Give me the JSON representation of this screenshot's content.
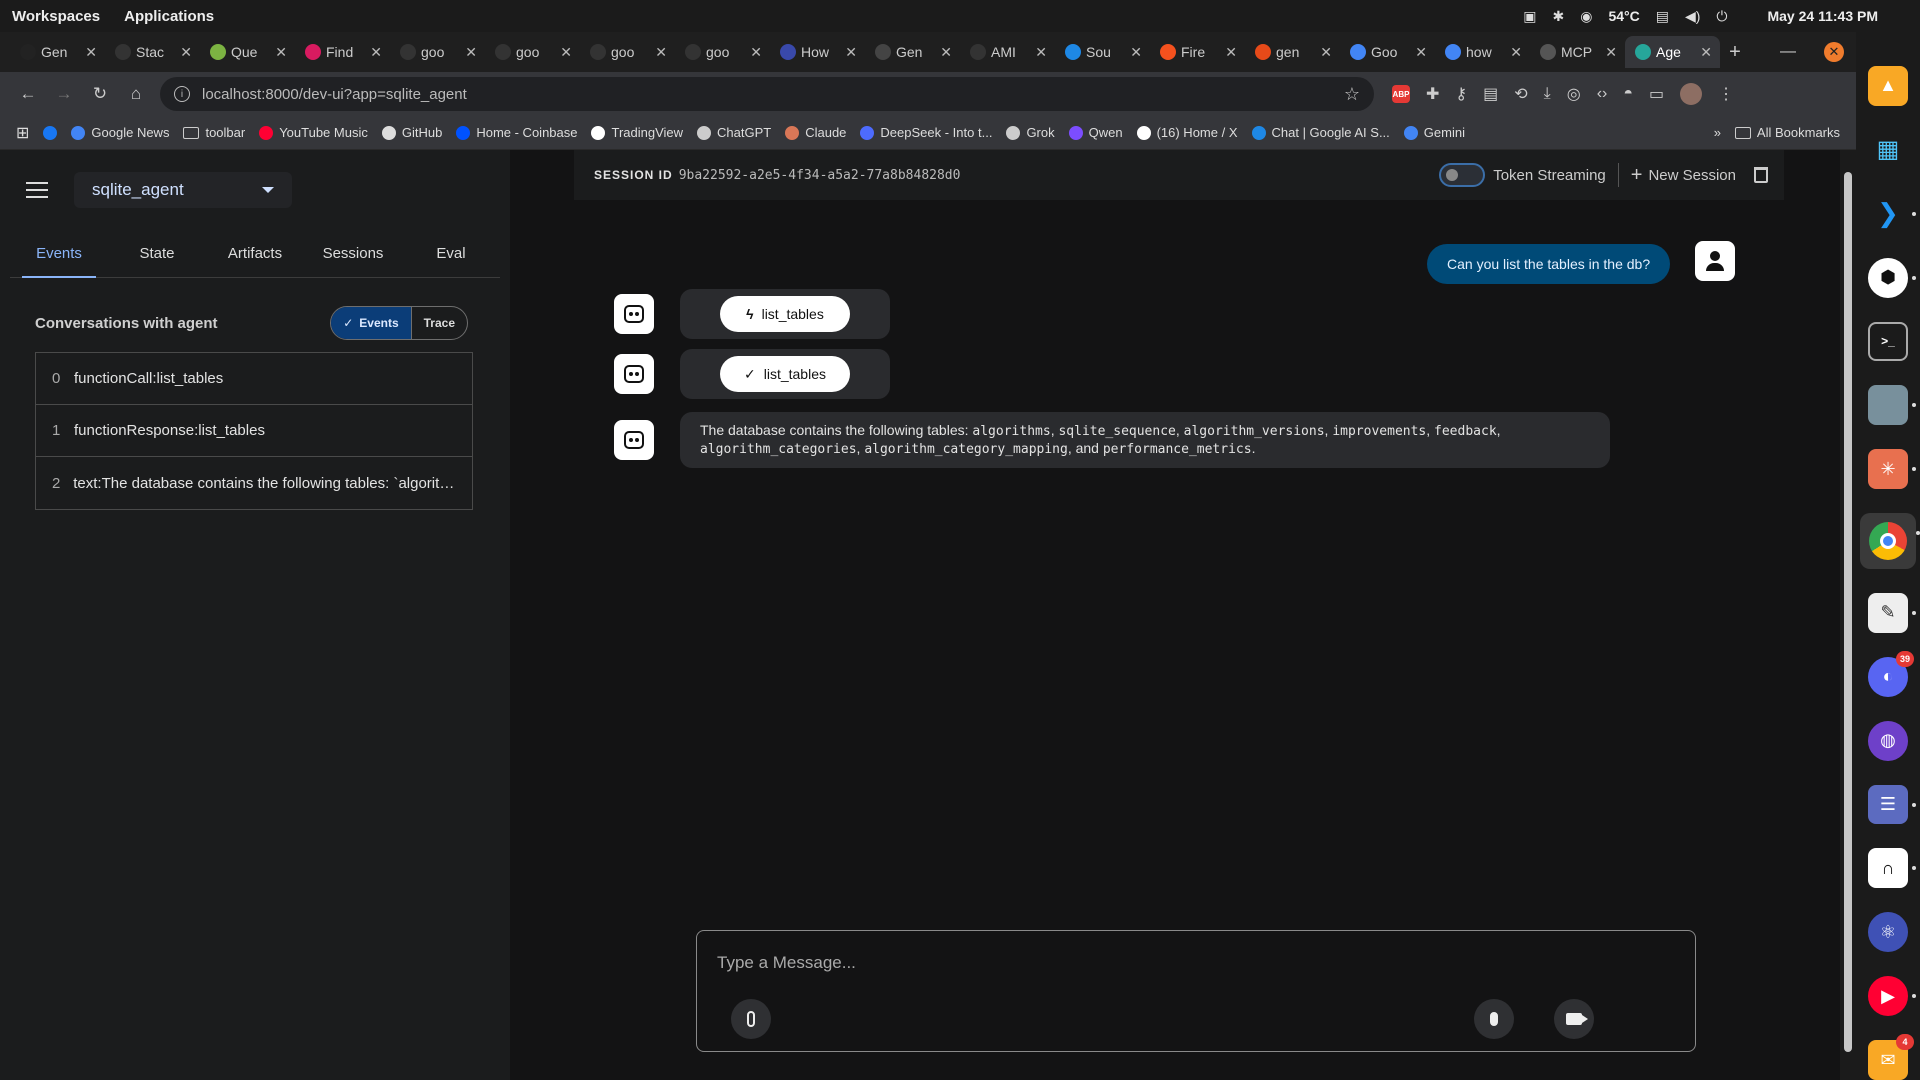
{
  "os": {
    "workspaces": "Workspaces",
    "applications": "Applications",
    "temperature": "54°C",
    "datetime": "May 24  11:43 PM"
  },
  "tabs": [
    {
      "label": "Gen",
      "icon": "openai-icon",
      "color": "#222222"
    },
    {
      "label": "Stac",
      "icon": "github-icon",
      "color": "#333333"
    },
    {
      "label": "Que",
      "icon": "quest-icon",
      "color": "#7cb342"
    },
    {
      "label": "Find",
      "icon": "find-icon",
      "color": "#d81b60"
    },
    {
      "label": "goo",
      "icon": "github-icon",
      "color": "#333333"
    },
    {
      "label": "goo",
      "icon": "github-icon",
      "color": "#333333"
    },
    {
      "label": "goo",
      "icon": "github-icon",
      "color": "#333333"
    },
    {
      "label": "goo",
      "icon": "github-icon",
      "color": "#333333"
    },
    {
      "label": "How",
      "icon": "how-icon",
      "color": "#3949ab"
    },
    {
      "label": "Gen",
      "icon": "zb-icon",
      "color": "#444444"
    },
    {
      "label": "AMI",
      "icon": "github-icon",
      "color": "#333333"
    },
    {
      "label": "Sou",
      "icon": "butterfly-icon",
      "color": "#1e88e5"
    },
    {
      "label": "Fire",
      "icon": "fire-icon",
      "color": "#f4511e"
    },
    {
      "label": "gen",
      "icon": "flame-icon",
      "color": "#e64a19"
    },
    {
      "label": "Goo",
      "icon": "gemini-icon",
      "color": "#4285f4"
    },
    {
      "label": "how",
      "icon": "google-icon",
      "color": "#4285f4"
    },
    {
      "label": "MCP",
      "icon": "mcp-icon",
      "color": "#555555"
    },
    {
      "label": "Age",
      "icon": "agent-icon",
      "color": "#26a69a"
    }
  ],
  "address": {
    "url": "localhost:8000/dev-ui?app=sqlite_agent"
  },
  "bookmarks": [
    {
      "label": "",
      "color": "#1877f2"
    },
    {
      "label": "Google News",
      "color": "#4285f4"
    },
    {
      "label": "toolbar",
      "folder": true
    },
    {
      "label": "YouTube Music",
      "color": "#ff0033"
    },
    {
      "label": "GitHub",
      "color": "#dddddd"
    },
    {
      "label": "Home - Coinbase",
      "color": "#0052ff"
    },
    {
      "label": "TradingView",
      "color": "#ffffff"
    },
    {
      "label": "ChatGPT",
      "color": "#cccccc"
    },
    {
      "label": "Claude",
      "color": "#d97757"
    },
    {
      "label": "DeepSeek - Into t...",
      "color": "#4d6bfe"
    },
    {
      "label": "Grok",
      "color": "#cccccc"
    },
    {
      "label": "Qwen",
      "color": "#7c4dff"
    },
    {
      "label": "(16) Home / X",
      "color": "#ffffff"
    },
    {
      "label": "Chat | Google AI S...",
      "color": "#1e88e5"
    },
    {
      "label": "Gemini",
      "color": "#4285f4"
    }
  ],
  "all_bookmarks": "All Bookmarks",
  "sidebar": {
    "app_name": "sqlite_agent",
    "tabs": [
      "Events",
      "State",
      "Artifacts",
      "Sessions",
      "Eval"
    ],
    "conversations_title": "Conversations with agent",
    "toggle_events": "Events",
    "toggle_trace": "Trace",
    "events": [
      {
        "index": "0",
        "text": "functionCall:list_tables"
      },
      {
        "index": "1",
        "text": "functionResponse:list_tables"
      },
      {
        "index": "2",
        "text": "text:The database contains the following tables: `algorithm..."
      }
    ]
  },
  "session": {
    "label": "SESSION ID",
    "id": "9ba22592-a2e5-4f34-a5a2-77a8b84828d0",
    "token_streaming": "Token Streaming",
    "new_session": "New Session"
  },
  "chat": {
    "user_message": "Can you list the tables in the db?",
    "function_call": "list_tables",
    "function_response": "list_tables",
    "response_prefix": "The database contains the following tables: ",
    "tables": [
      "algorithms",
      "sqlite_sequence",
      "algorithm_versions",
      "improvements",
      "feedback",
      "algorithm_categories",
      "algorithm_category_mapping"
    ],
    "and_word": ", and ",
    "last_table": "performance_metrics",
    "placeholder": "Type a Message..."
  },
  "dock": {
    "discord_badge": "39",
    "mail_badge": "4"
  }
}
